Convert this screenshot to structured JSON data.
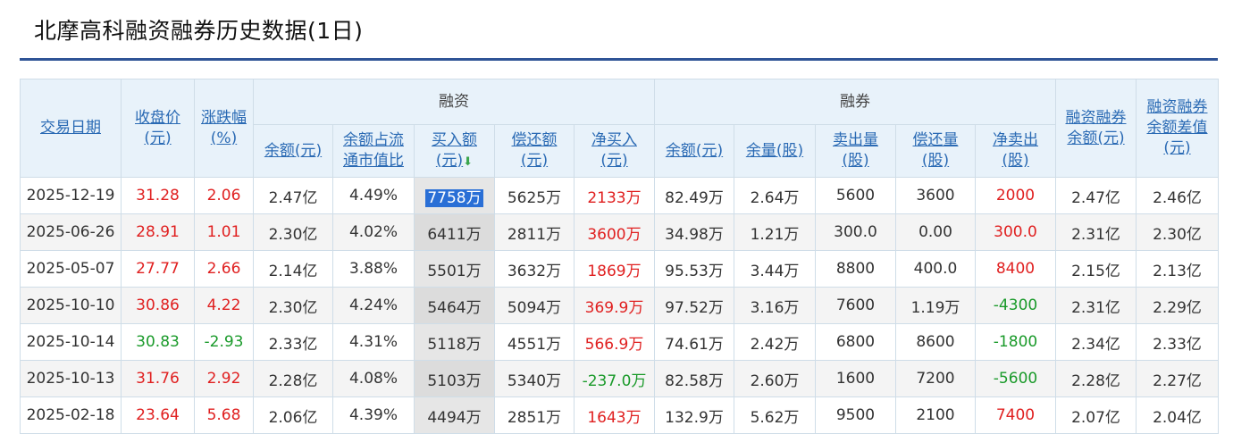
{
  "page": {
    "title": "北摩高科融资融券历史数据(1日)"
  },
  "header": {
    "groups": {
      "margin": "融资",
      "short": "融券"
    },
    "columns": {
      "date": "交易日期",
      "close_a": "收盘价",
      "close_b": "(元)",
      "change_a": "涨跌幅",
      "change_b": "(%)",
      "rz_balance": "余额(元)",
      "rz_ratio_a": "余额占流",
      "rz_ratio_b": "通市值比",
      "rz_buy_a": "买入额",
      "rz_buy_b": "(元)",
      "rz_repay_a": "偿还额",
      "rz_repay_b": "(元)",
      "rz_net_a": "净买入",
      "rz_net_b": "(元)",
      "rq_balance": "余额(元)",
      "rq_volume": "余量(股)",
      "rq_sell_a": "卖出量",
      "rq_sell_b": "(股)",
      "rq_repay_a": "偿还量",
      "rq_repay_b": "(股)",
      "rq_net_a": "净卖出",
      "rq_net_b": "(股)",
      "total_a": "融资融券",
      "total_b": "余额(元)",
      "diff_a": "融资融券",
      "diff_b": "余额差值",
      "diff_c": "(元)"
    },
    "sort_icon": "arrow-down-icon"
  },
  "colors": {
    "up": "#e02020",
    "down": "#1a9a2a",
    "header_bg": "#e8f2fa",
    "accent": "#2f5496"
  },
  "rows": [
    {
      "date": "2025-12-19",
      "close": "31.28",
      "change": "2.06",
      "rz_balance": "2.47亿",
      "rz_ratio": "4.49%",
      "rz_buy": "7758万",
      "rz_repay": "5625万",
      "rz_net": "2133万",
      "rq_balance": "82.49万",
      "rq_volume": "2.64万",
      "rq_sell": "5600",
      "rq_repay": "3600",
      "rq_net": "2000",
      "total": "2.47亿",
      "diff": "2.46亿",
      "dir": "up",
      "net_dir": "up",
      "rq_dir": "up"
    },
    {
      "date": "2025-06-26",
      "close": "28.91",
      "change": "1.01",
      "rz_balance": "2.30亿",
      "rz_ratio": "4.02%",
      "rz_buy": "6411万",
      "rz_repay": "2811万",
      "rz_net": "3600万",
      "rq_balance": "34.98万",
      "rq_volume": "1.21万",
      "rq_sell": "300.0",
      "rq_repay": "0.00",
      "rq_net": "300.0",
      "total": "2.31亿",
      "diff": "2.30亿",
      "dir": "up",
      "net_dir": "up",
      "rq_dir": "up"
    },
    {
      "date": "2025-05-07",
      "close": "27.77",
      "change": "2.66",
      "rz_balance": "2.14亿",
      "rz_ratio": "3.88%",
      "rz_buy": "5501万",
      "rz_repay": "3632万",
      "rz_net": "1869万",
      "rq_balance": "95.53万",
      "rq_volume": "3.44万",
      "rq_sell": "8800",
      "rq_repay": "400.0",
      "rq_net": "8400",
      "total": "2.15亿",
      "diff": "2.13亿",
      "dir": "up",
      "net_dir": "up",
      "rq_dir": "up"
    },
    {
      "date": "2025-10-10",
      "close": "30.86",
      "change": "4.22",
      "rz_balance": "2.30亿",
      "rz_ratio": "4.24%",
      "rz_buy": "5464万",
      "rz_repay": "5094万",
      "rz_net": "369.9万",
      "rq_balance": "97.52万",
      "rq_volume": "3.16万",
      "rq_sell": "7600",
      "rq_repay": "1.19万",
      "rq_net": "-4300",
      "total": "2.31亿",
      "diff": "2.29亿",
      "dir": "up",
      "net_dir": "up",
      "rq_dir": "down"
    },
    {
      "date": "2025-10-14",
      "close": "30.83",
      "change": "-2.93",
      "rz_balance": "2.33亿",
      "rz_ratio": "4.31%",
      "rz_buy": "5118万",
      "rz_repay": "4551万",
      "rz_net": "566.9万",
      "rq_balance": "74.61万",
      "rq_volume": "2.42万",
      "rq_sell": "6800",
      "rq_repay": "8600",
      "rq_net": "-1800",
      "total": "2.34亿",
      "diff": "2.33亿",
      "dir": "down",
      "net_dir": "up",
      "rq_dir": "down"
    },
    {
      "date": "2025-10-13",
      "close": "31.76",
      "change": "2.92",
      "rz_balance": "2.28亿",
      "rz_ratio": "4.08%",
      "rz_buy": "5103万",
      "rz_repay": "5340万",
      "rz_net": "-237.0万",
      "rq_balance": "82.58万",
      "rq_volume": "2.60万",
      "rq_sell": "1600",
      "rq_repay": "7200",
      "rq_net": "-5600",
      "total": "2.28亿",
      "diff": "2.27亿",
      "dir": "up",
      "net_dir": "down",
      "rq_dir": "down"
    },
    {
      "date": "2025-02-18",
      "close": "23.64",
      "change": "5.68",
      "rz_balance": "2.06亿",
      "rz_ratio": "4.39%",
      "rz_buy": "4494万",
      "rz_repay": "2851万",
      "rz_net": "1643万",
      "rq_balance": "132.9万",
      "rq_volume": "5.62万",
      "rq_sell": "9500",
      "rq_repay": "2100",
      "rq_net": "7400",
      "total": "2.07亿",
      "diff": "2.04亿",
      "dir": "up",
      "net_dir": "up",
      "rq_dir": "up"
    }
  ]
}
